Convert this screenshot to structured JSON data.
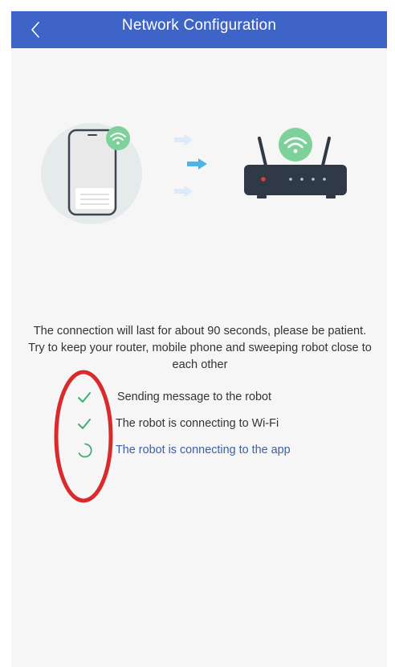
{
  "header": {
    "title": "Network Configuration",
    "background": "#3d64c6"
  },
  "instructions": {
    "text": "The connection will last for about 90 seconds, please be patient. Try to keep your router, mobile phone and sweeping robot close to each other"
  },
  "steps": [
    {
      "label": "Sending message to the robot",
      "status": "done",
      "icon": "check-icon"
    },
    {
      "label": "The robot is connecting to Wi-Fi",
      "status": "done",
      "icon": "check-icon"
    },
    {
      "label": "The robot is connecting to the app",
      "status": "in-progress",
      "icon": "spinner-icon"
    }
  ],
  "colors": {
    "accent": "#3d64c6",
    "check": "#3fae72",
    "wifi_badge": "#7ed19a",
    "annotation": "#d92b2b"
  }
}
